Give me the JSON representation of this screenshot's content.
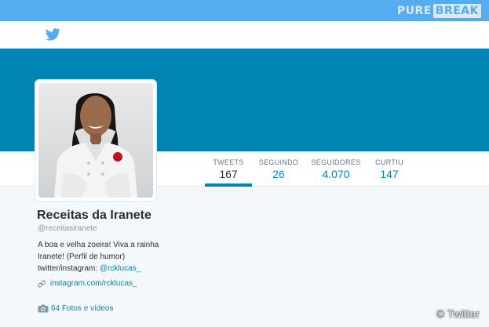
{
  "watermark": {
    "part1": "PURE",
    "part2": "BREAK"
  },
  "nav": {
    "logo_icon": "twitter-bird-icon"
  },
  "stats": [
    {
      "label": "TWEETS",
      "value": "167",
      "active": true
    },
    {
      "label": "SEGUINDO",
      "value": "26"
    },
    {
      "label": "SEGUIDORES",
      "value": "4.070"
    },
    {
      "label": "CURTIU",
      "value": "147"
    }
  ],
  "profile": {
    "name": "Receitas da Iranete",
    "handle": "@receitasiranete",
    "bio_line1": "A boa e velha zoeira! Viva a rainha",
    "bio_line2": "Iranete! (Perfil de humor)",
    "bio_line3_prefix": "twitter/instagram:",
    "bio_line3_link": "@rcklucas_",
    "website": "instagram.com/rcklucas_",
    "website_icon": "link-icon",
    "photos": "64 Fotos e vídeos",
    "photos_icon": "camera-icon"
  },
  "credit": "© Twitter",
  "colors": {
    "topbar": "#55acee",
    "banner": "#0084b4",
    "link": "#0084b4"
  }
}
